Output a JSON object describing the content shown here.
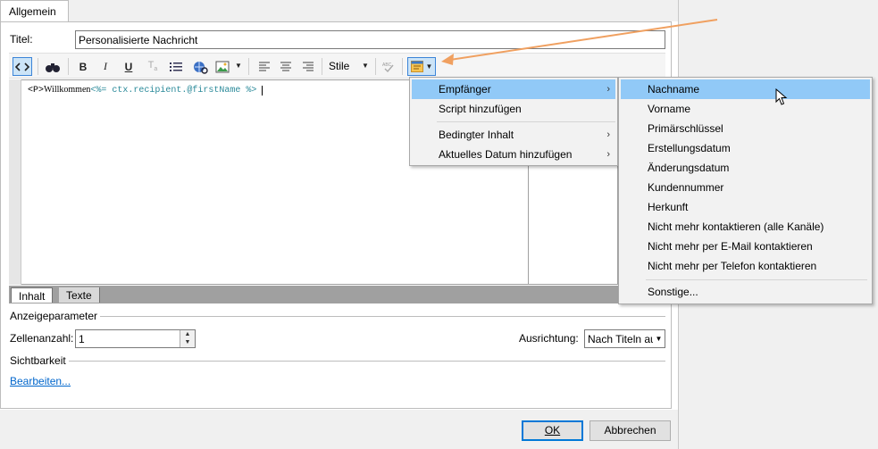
{
  "tabs": {
    "general": "Allgemein"
  },
  "title": {
    "label": "Titel:",
    "value": "Personalisierte Nachricht"
  },
  "toolbar": {
    "style_label": "Stile"
  },
  "editor": {
    "tag": "<P>",
    "word": "Willkommen",
    "expr": "<%= ctx.recipient.@firstName %>"
  },
  "editor_tabs": {
    "content": "Inhalt",
    "texts": "Texte"
  },
  "display_params": {
    "group": "Anzeigeparameter",
    "cell_count_label": "Zellenanzahl:",
    "cell_count_value": "1",
    "alignment_label": "Ausrichtung:",
    "alignment_value": "Nach Titeln au"
  },
  "visibility": {
    "group": "Sichtbarkeit",
    "edit_link": "Bearbeiten..."
  },
  "buttons": {
    "ok": "OK",
    "cancel": "Abbrechen"
  },
  "menu": {
    "items": [
      "Empfänger",
      "Script hinzufügen",
      "Bedingter Inhalt",
      "Aktuelles Datum hinzufügen"
    ]
  },
  "submenu": {
    "items": [
      "Nachname",
      "Vorname",
      "Primärschlüssel",
      "Erstellungsdatum",
      "Änderungsdatum",
      "Kundennummer",
      "Herkunft",
      "Nicht mehr kontaktieren (alle Kanäle)",
      "Nicht mehr per E-Mail kontaktieren",
      "Nicht mehr per Telefon kontaktieren",
      "Sonstige..."
    ]
  },
  "colors": {
    "highlight": "#91c9f7",
    "annotation_arrow": "#f0a060",
    "link": "#0066cc"
  }
}
